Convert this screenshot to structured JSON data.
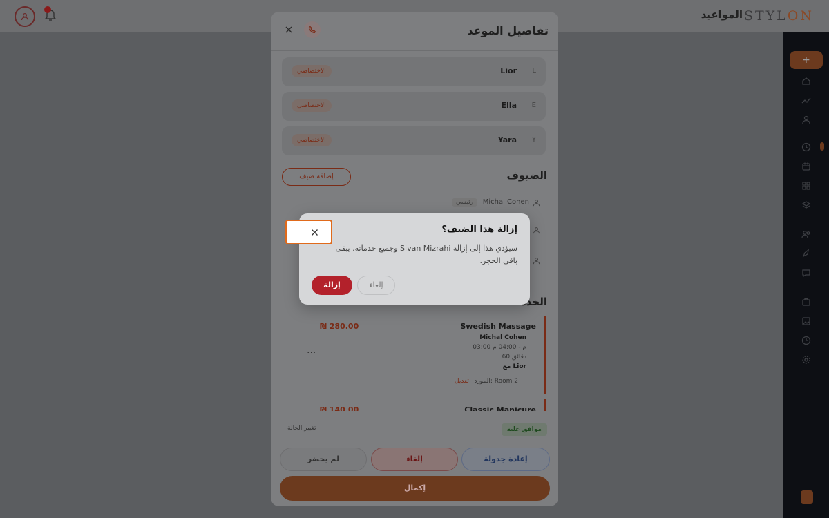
{
  "header": {
    "brand_main": "STYL",
    "brand_accent": "ON",
    "nav_appointments": "المواعيد"
  },
  "panel": {
    "title": "تفاصيل الموعد",
    "professionals": [
      {
        "letter": "L",
        "name": "Lior",
        "tag": "الاختصاصي"
      },
      {
        "letter": "E",
        "name": "Ella",
        "tag": "الاختصاصي"
      },
      {
        "letter": "Y",
        "name": "Yara",
        "tag": "الاختصاصي"
      }
    ],
    "guests_title": "الضيوف",
    "add_guest_label": "إضافة ضيف",
    "guests": [
      {
        "name": "Michal Cohen",
        "tag": "رئيسي"
      }
    ],
    "services_title": "الخدمات",
    "services": [
      {
        "name": "Swedish Massage",
        "price": "₪ 280.00",
        "guest": "Michal Cohen",
        "time": "03:00 م - 04:00 م",
        "duration": "60 دقائق",
        "with": "مع Lior",
        "resource": "المورد: Room 2",
        "edit_label": "تعديل"
      },
      {
        "name": "Classic Manicure",
        "price": "₪ 140.00"
      }
    ],
    "status_label": "موافق عليه",
    "change_status_label": "تغيير الحالة",
    "actions": {
      "reschedule": "إعادة جدولة",
      "cancel": "إلغاء",
      "no_show": "لم يحضر",
      "complete": "إكمال"
    }
  },
  "dialog": {
    "title": "إزالة هذا الضيف؟",
    "body": "سيؤدي هذا إلى إزالة Sivan Mizrahi وجميع خدماته. يبقى باقي الحجز.",
    "remove_label": "إزالة",
    "cancel_label": "إلغاء"
  },
  "colors": {
    "accent": "#e06a1b",
    "danger": "#b3212b",
    "sidebar": "#0d0f14"
  }
}
